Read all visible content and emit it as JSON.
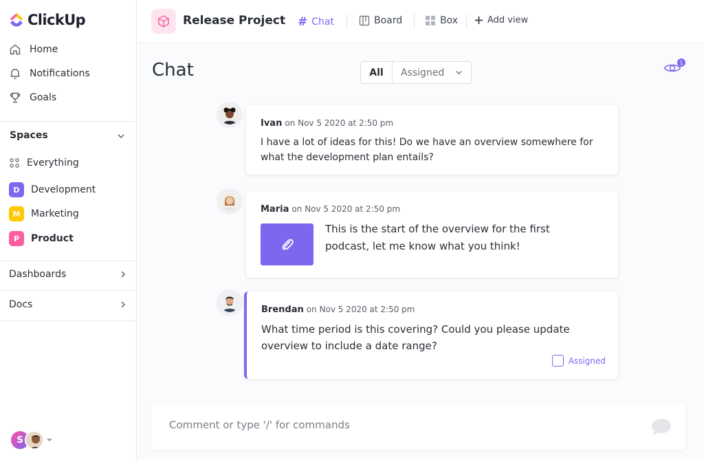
{
  "app": {
    "name": "ClickUp"
  },
  "sidebar": {
    "nav": [
      {
        "label": "Home",
        "icon": "home-icon"
      },
      {
        "label": "Notifications",
        "icon": "bell-icon"
      },
      {
        "label": "Goals",
        "icon": "trophy-icon"
      }
    ],
    "spaces_title": "Spaces",
    "spaces": [
      {
        "label": "Everything",
        "icon": "grid-dots-icon"
      },
      {
        "label": "Development",
        "badge": "D",
        "color": "#7b68ee"
      },
      {
        "label": "Marketing",
        "badge": "M",
        "color": "#ffc800"
      },
      {
        "label": "Product",
        "badge": "P",
        "color": "#ff5fa0"
      }
    ],
    "dashboards": "Dashboards",
    "docs": "Docs",
    "user_initial": "S"
  },
  "topbar": {
    "project": "Release Project",
    "views": [
      {
        "label": "Chat",
        "icon": "hash-icon",
        "active": true
      },
      {
        "label": "Board",
        "icon": "board-icon"
      },
      {
        "label": "Box",
        "icon": "box-grid-icon"
      }
    ],
    "add_view": "Add view"
  },
  "chat": {
    "title": "Chat",
    "filters": {
      "all": "All",
      "assigned": "Assigned"
    },
    "watchers": "1",
    "messages": [
      {
        "author": "Ivan",
        "time": "on Nov 5 2020 at 2:50 pm",
        "text": "I have a lot of ideas for this! Do we have an overview somewhere for what the development plan entails?"
      },
      {
        "author": "Maria",
        "time": "on Nov 5 2020 at 2:50 pm",
        "text": "This is the start of the overview for the first podcast, let me know what you think!"
      },
      {
        "author": "Brendan",
        "time": "on Nov 5 2020 at 2:50 pm",
        "text": "What time period is this covering? Could you please update overview to include a date range?",
        "assigned_label": "Assigned"
      }
    ],
    "comment_placeholder": "Comment or type '/' for commands"
  },
  "colors": {
    "accent": "#7b68ee"
  }
}
